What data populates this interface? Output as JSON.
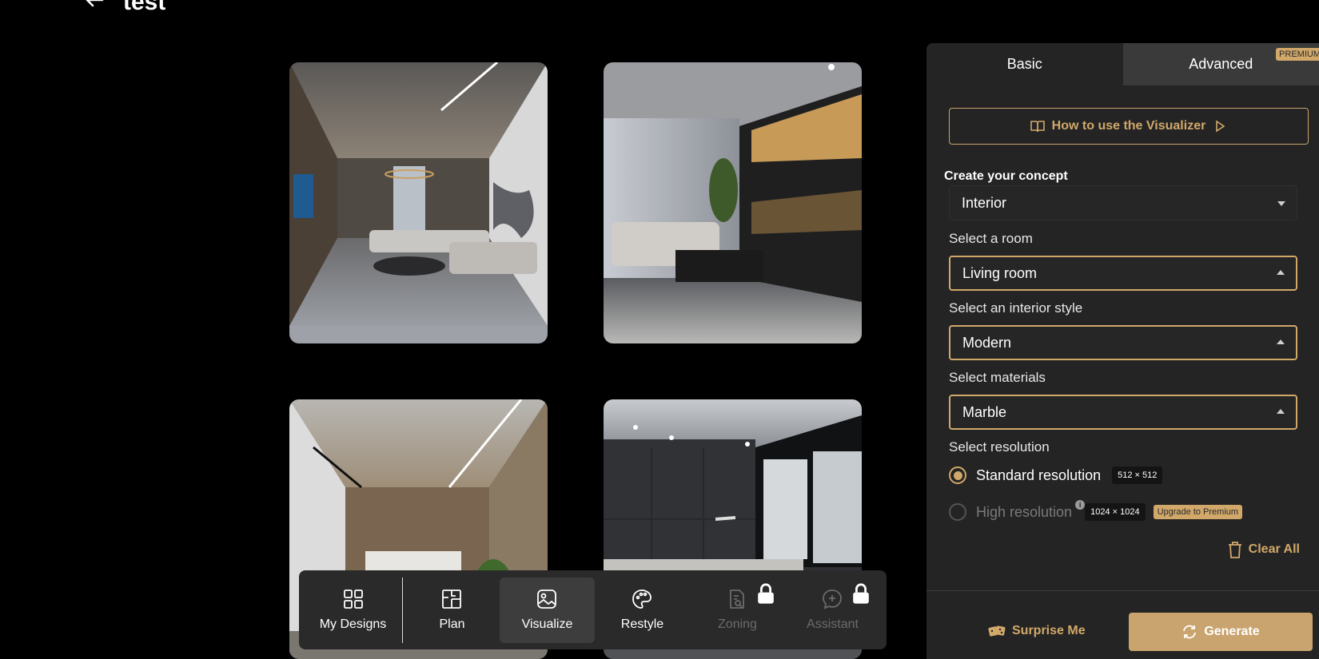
{
  "header": {
    "title": "test"
  },
  "gallery": {
    "images": [
      {
        "alt": "modern-living-room-marble-wall"
      },
      {
        "alt": "modern-living-room-led-shelves"
      },
      {
        "alt": "modern-open-kitchen-led-ceiling"
      },
      {
        "alt": "modern-bedroom-window-view"
      }
    ]
  },
  "toolbar": {
    "items": [
      {
        "label": "My Designs",
        "icon": "grid-icon",
        "state": "normal"
      },
      {
        "label": "Plan",
        "icon": "floorplan-icon",
        "state": "normal"
      },
      {
        "label": "Visualize",
        "icon": "image-icon",
        "state": "active"
      },
      {
        "label": "Restyle",
        "icon": "palette-icon",
        "state": "normal"
      },
      {
        "label": "Zoning",
        "icon": "document-search-icon",
        "state": "locked"
      },
      {
        "label": "Assistant",
        "icon": "chat-plus-icon",
        "state": "locked"
      }
    ]
  },
  "panel": {
    "tabs": {
      "basic": "Basic",
      "advanced": "Advanced",
      "premium_badge": "PREMIUM"
    },
    "howto_label": "How to use the Visualizer",
    "concept": {
      "label": "Create your concept",
      "value": "Interior"
    },
    "room": {
      "label": "Select a room",
      "value": "Living room"
    },
    "style": {
      "label": "Select an interior style",
      "value": "Modern"
    },
    "materials": {
      "label": "Select materials",
      "value": "Marble"
    },
    "resolution": {
      "label": "Select resolution",
      "standard": {
        "label": "Standard resolution",
        "size": "512 × 512",
        "selected": true
      },
      "high": {
        "label": "High resolution",
        "size": "1024 × 1024",
        "upgrade": "Upgrade to Premium",
        "info": "i",
        "selected": false
      }
    },
    "clear_all": "Clear All",
    "surprise_me": "Surprise Me",
    "generate": "Generate"
  },
  "colors": {
    "accent": "#d1a86a",
    "panel_bg": "#242424",
    "toolbar_bg": "#2a2a2a"
  }
}
